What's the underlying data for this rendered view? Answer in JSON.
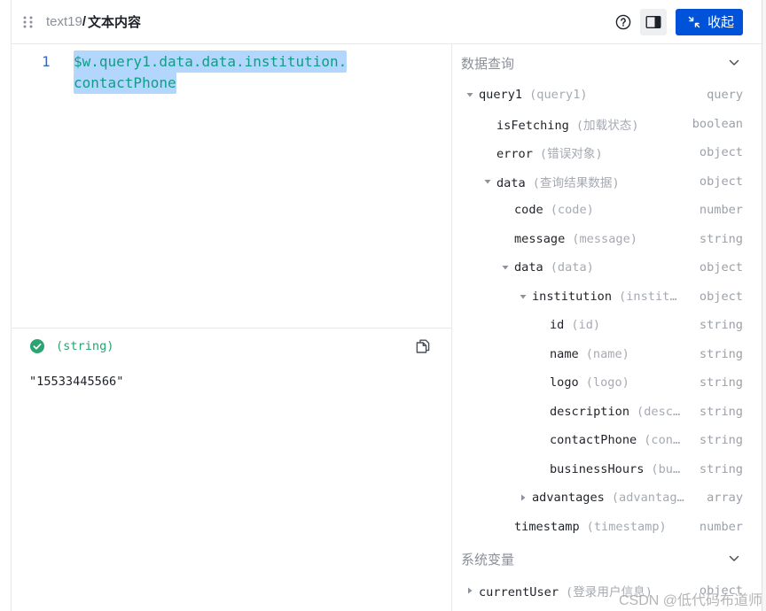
{
  "header": {
    "component_id": "text19",
    "separator": "/",
    "title": "文本内容",
    "collapse_label": "收起"
  },
  "editor": {
    "line_numbers": [
      "1"
    ],
    "code": "$w.query1.data.data.institution.contactPhone"
  },
  "result": {
    "type_label": "(string)",
    "value": "\"15533445566\""
  },
  "sections": [
    {
      "title": "数据查询",
      "expanded": true,
      "tree": [
        {
          "key": "query1",
          "label": "(query1)",
          "type": "query",
          "expanded": true,
          "children": [
            {
              "key": "isFetching",
              "label": "(加载状态)",
              "type": "boolean"
            },
            {
              "key": "error",
              "label": "(错误对象)",
              "type": "object"
            },
            {
              "key": "data",
              "label": "(查询结果数据)",
              "type": "object",
              "expanded": true,
              "children": [
                {
                  "key": "code",
                  "label": "(code)",
                  "type": "number"
                },
                {
                  "key": "message",
                  "label": "(message)",
                  "type": "string"
                },
                {
                  "key": "data",
                  "label": "(data)",
                  "type": "object",
                  "expanded": true,
                  "children": [
                    {
                      "key": "institution",
                      "label": "(instit…",
                      "type": "object",
                      "expanded": true,
                      "children": [
                        {
                          "key": "id",
                          "label": "(id)",
                          "type": "string"
                        },
                        {
                          "key": "name",
                          "label": "(name)",
                          "type": "string"
                        },
                        {
                          "key": "logo",
                          "label": "(logo)",
                          "type": "string"
                        },
                        {
                          "key": "description",
                          "label": "(desc…",
                          "type": "string"
                        },
                        {
                          "key": "contactPhone",
                          "label": "(con…",
                          "type": "string"
                        },
                        {
                          "key": "businessHours",
                          "label": "(bu…",
                          "type": "string"
                        }
                      ]
                    },
                    {
                      "key": "advantages",
                      "label": "(advantag…",
                      "type": "array",
                      "expanded": false
                    }
                  ]
                },
                {
                  "key": "timestamp",
                  "label": "(timestamp)",
                  "type": "number"
                }
              ]
            }
          ]
        }
      ]
    },
    {
      "title": "系统变量",
      "expanded": true,
      "tree": [
        {
          "key": "currentUser",
          "label": "(登录用户信息)",
          "type": "object",
          "expanded": false
        }
      ]
    }
  ],
  "watermark": "CSDN @低代码布道师",
  "icons": {
    "drag": "drag-handle-icon",
    "help": "help-circle-icon",
    "panel_toggle": "sidebar-toggle-icon",
    "collapse": "shrink-icon",
    "result_status": "check-circle-icon",
    "copy": "copy-icon",
    "section_toggle": "chevron-down-icon",
    "node_expanded": "caret-down-icon",
    "node_collapsed": "caret-right-icon"
  },
  "colors": {
    "primary": "#0052d9",
    "success": "#2ba471",
    "code_text": "#0f9d86",
    "selection": "#b3d7fc",
    "line_number": "#3a6ab4"
  }
}
